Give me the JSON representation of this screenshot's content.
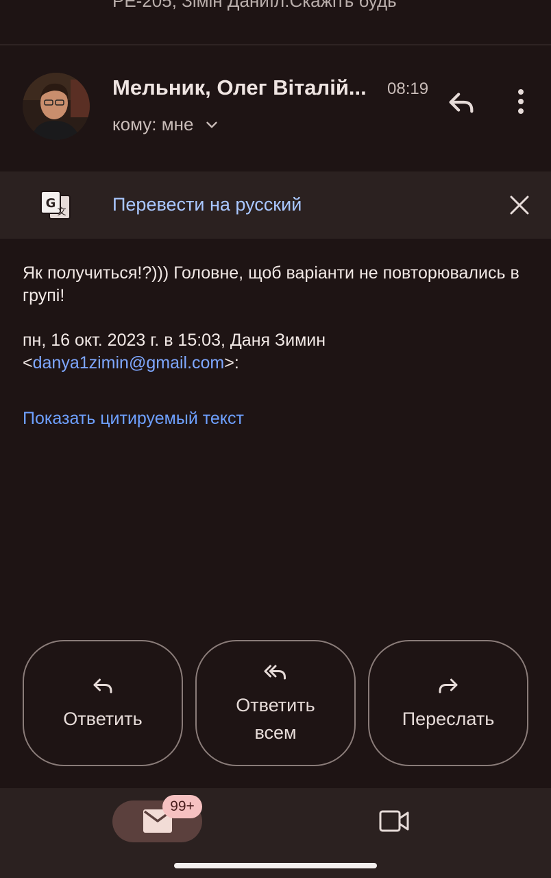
{
  "previous_message": {
    "snippet": "РЕ-205, Зімін Даниїл.Скажіть будь"
  },
  "header": {
    "sender_name": "Мельник, Олег Віталій...",
    "time": "08:19",
    "recipient_label": "кому: мне",
    "icons": {
      "avatar": "avatar-photo",
      "recipient_toggle": "chevron-down-icon",
      "reply": "reply-icon",
      "more": "more-vert-icon"
    }
  },
  "translate_bar": {
    "label": "Перевести на русский",
    "icons": {
      "translate": "translate-icon",
      "close": "close-icon"
    }
  },
  "message": {
    "body": "Як получиться!?))) Головне, щоб варіанти не повторювались в групі!",
    "quote_header_prefix": "пн, 16 окт. 2023 г. в 15:03, Даня Зимин <",
    "quote_email": "danya1zimin@gmail.com",
    "quote_header_suffix": ">:",
    "show_quoted_label": "Показать цитируемый текст"
  },
  "actions": {
    "reply_label": "Ответить",
    "reply_all_label": "Ответить всем",
    "forward_label": "Переслать",
    "icons": {
      "reply": "reply-icon",
      "reply_all": "reply-all-icon",
      "forward": "forward-icon"
    }
  },
  "bottom_nav": {
    "mail_badge": "99+",
    "icons": {
      "mail": "mail-icon",
      "meet": "video-camera-icon"
    }
  },
  "colors": {
    "background": "#1e1414",
    "surface": "#2b2120",
    "link": "#7ea7ff",
    "translate_link": "#a9c7ff",
    "badge": "#f6c1c1",
    "mail_pill": "#5b403d"
  }
}
